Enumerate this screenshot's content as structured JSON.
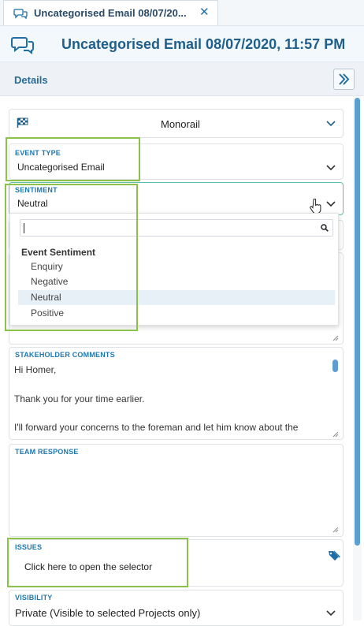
{
  "tab": {
    "title": "Uncategorised Email 08/07/20...",
    "icon": "chat-bubbles-icon",
    "close": "✕"
  },
  "header": {
    "title": "Uncategorised Email 08/07/2020, 11:57 PM",
    "icon": "chat-bubbles-icon"
  },
  "details": {
    "label": "Details",
    "expand_icon": "double-chevron-right-icon"
  },
  "project": {
    "value": "Monorail",
    "icon": "checkered-flag-icon"
  },
  "event_type": {
    "label": "EVENT TYPE",
    "value": "Uncategorised Email"
  },
  "sentiment": {
    "label": "SENTIMENT",
    "value": "Neutral",
    "search_placeholder": "",
    "group": "Event Sentiment",
    "options": [
      {
        "label": "Enquiry",
        "selected": false
      },
      {
        "label": "Negative",
        "selected": false
      },
      {
        "label": "Neutral",
        "selected": true
      },
      {
        "label": "Positive",
        "selected": false
      }
    ]
  },
  "stakeholder_comments": {
    "label": "STAKEHOLDER COMMENTS",
    "lines": [
      "Hi Homer,",
      "",
      "Thank you for your time earlier.",
      "",
      "I'll forward your concerns to the foreman and let him know about the"
    ]
  },
  "team_response": {
    "label": "TEAM RESPONSE",
    "value": ""
  },
  "issues": {
    "label": "ISSUES",
    "placeholder": "Click here to open the selector",
    "icon": "tag-icon"
  },
  "visibility": {
    "label": "VISIBILITY",
    "value": "Private (Visible to selected Projects only)"
  },
  "colors": {
    "accent": "#1e78b0",
    "header_text": "#1f5f8b",
    "highlight": "#8bc34a",
    "scrollbar": "#5b9fd0",
    "focus_border": "#5cc0b0"
  }
}
